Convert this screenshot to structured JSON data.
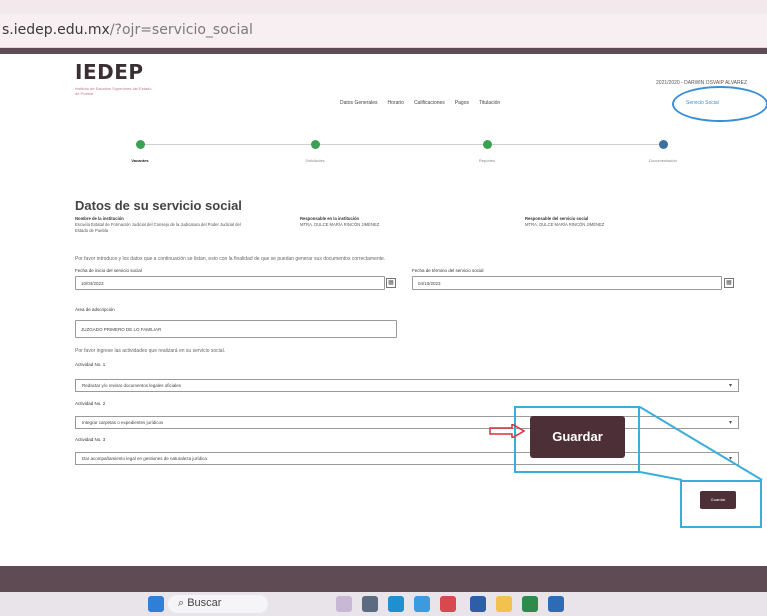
{
  "browser": {
    "url_host": "s.iedep.edu.mx",
    "url_path": "/?ojr=servicio_social"
  },
  "header": {
    "logo": "IEDEP",
    "logo_sub": "Instituto de Estudios Superiores del Estado de Puebla",
    "user": "2021/2020 - DARWIN OSVAIP ALVAREZ"
  },
  "nav": {
    "items": [
      "Datos Generales",
      "Horario",
      "Calificaciones",
      "Pagos",
      "Titulación"
    ],
    "active": "Servicio Social"
  },
  "steps": [
    "Vacantes",
    "Solicitudes",
    "Reportes",
    "Documentación"
  ],
  "section_title": "Datos de su servicio social",
  "info": [
    {
      "label": "Nombre de la institución",
      "value": "Escuela Estatal de Formación Judicial del Consejo de la Judicatura del Poder Judicial del Estado de Puebla"
    },
    {
      "label": "Responsable en la institución",
      "value": "MTRA. DULCE MARÍA RINCÓN JIMÉNEZ"
    },
    {
      "label": "Responsable del servicio social",
      "value": "MTRA. DULCE MARÍA RINCÓN JIMÉNEZ"
    }
  ],
  "note": "Por favor introduce y los datos que a continuación se listan, esto con la finalidad de que se puedan generar sus documentos correctamente.",
  "form": {
    "start_label": "Fecha de inicio del servicio social",
    "start_value": "10/04/2023",
    "end_label": "Fecha de término del servicio social",
    "end_value": "04/10/2023",
    "area_label": "Área de adscripción",
    "area_value": "JUZGADO PRIMERO DE LO FAMILIAR",
    "activities_note": "Por favor ingrese las actividades que realizará en su servicio social.",
    "activities": [
      {
        "label": "Actividad No. 1",
        "value": "Redactar y/o revisar documentos legales oficiales"
      },
      {
        "label": "Actividad No. 2",
        "value": "Integrar carpetas o expedientes jurídicos"
      },
      {
        "label": "Actividad No. 3",
        "value": "Dar acompañamiento legal en gestiones de naturaleza jurídica"
      }
    ]
  },
  "buttons": {
    "save_large": "Guardar",
    "save_small": "Guardar"
  },
  "taskbar": {
    "search": "Buscar"
  },
  "colors": {
    "brand": "#4d2f37",
    "highlight": "#3aaed8",
    "step_done": "#3aa052"
  }
}
